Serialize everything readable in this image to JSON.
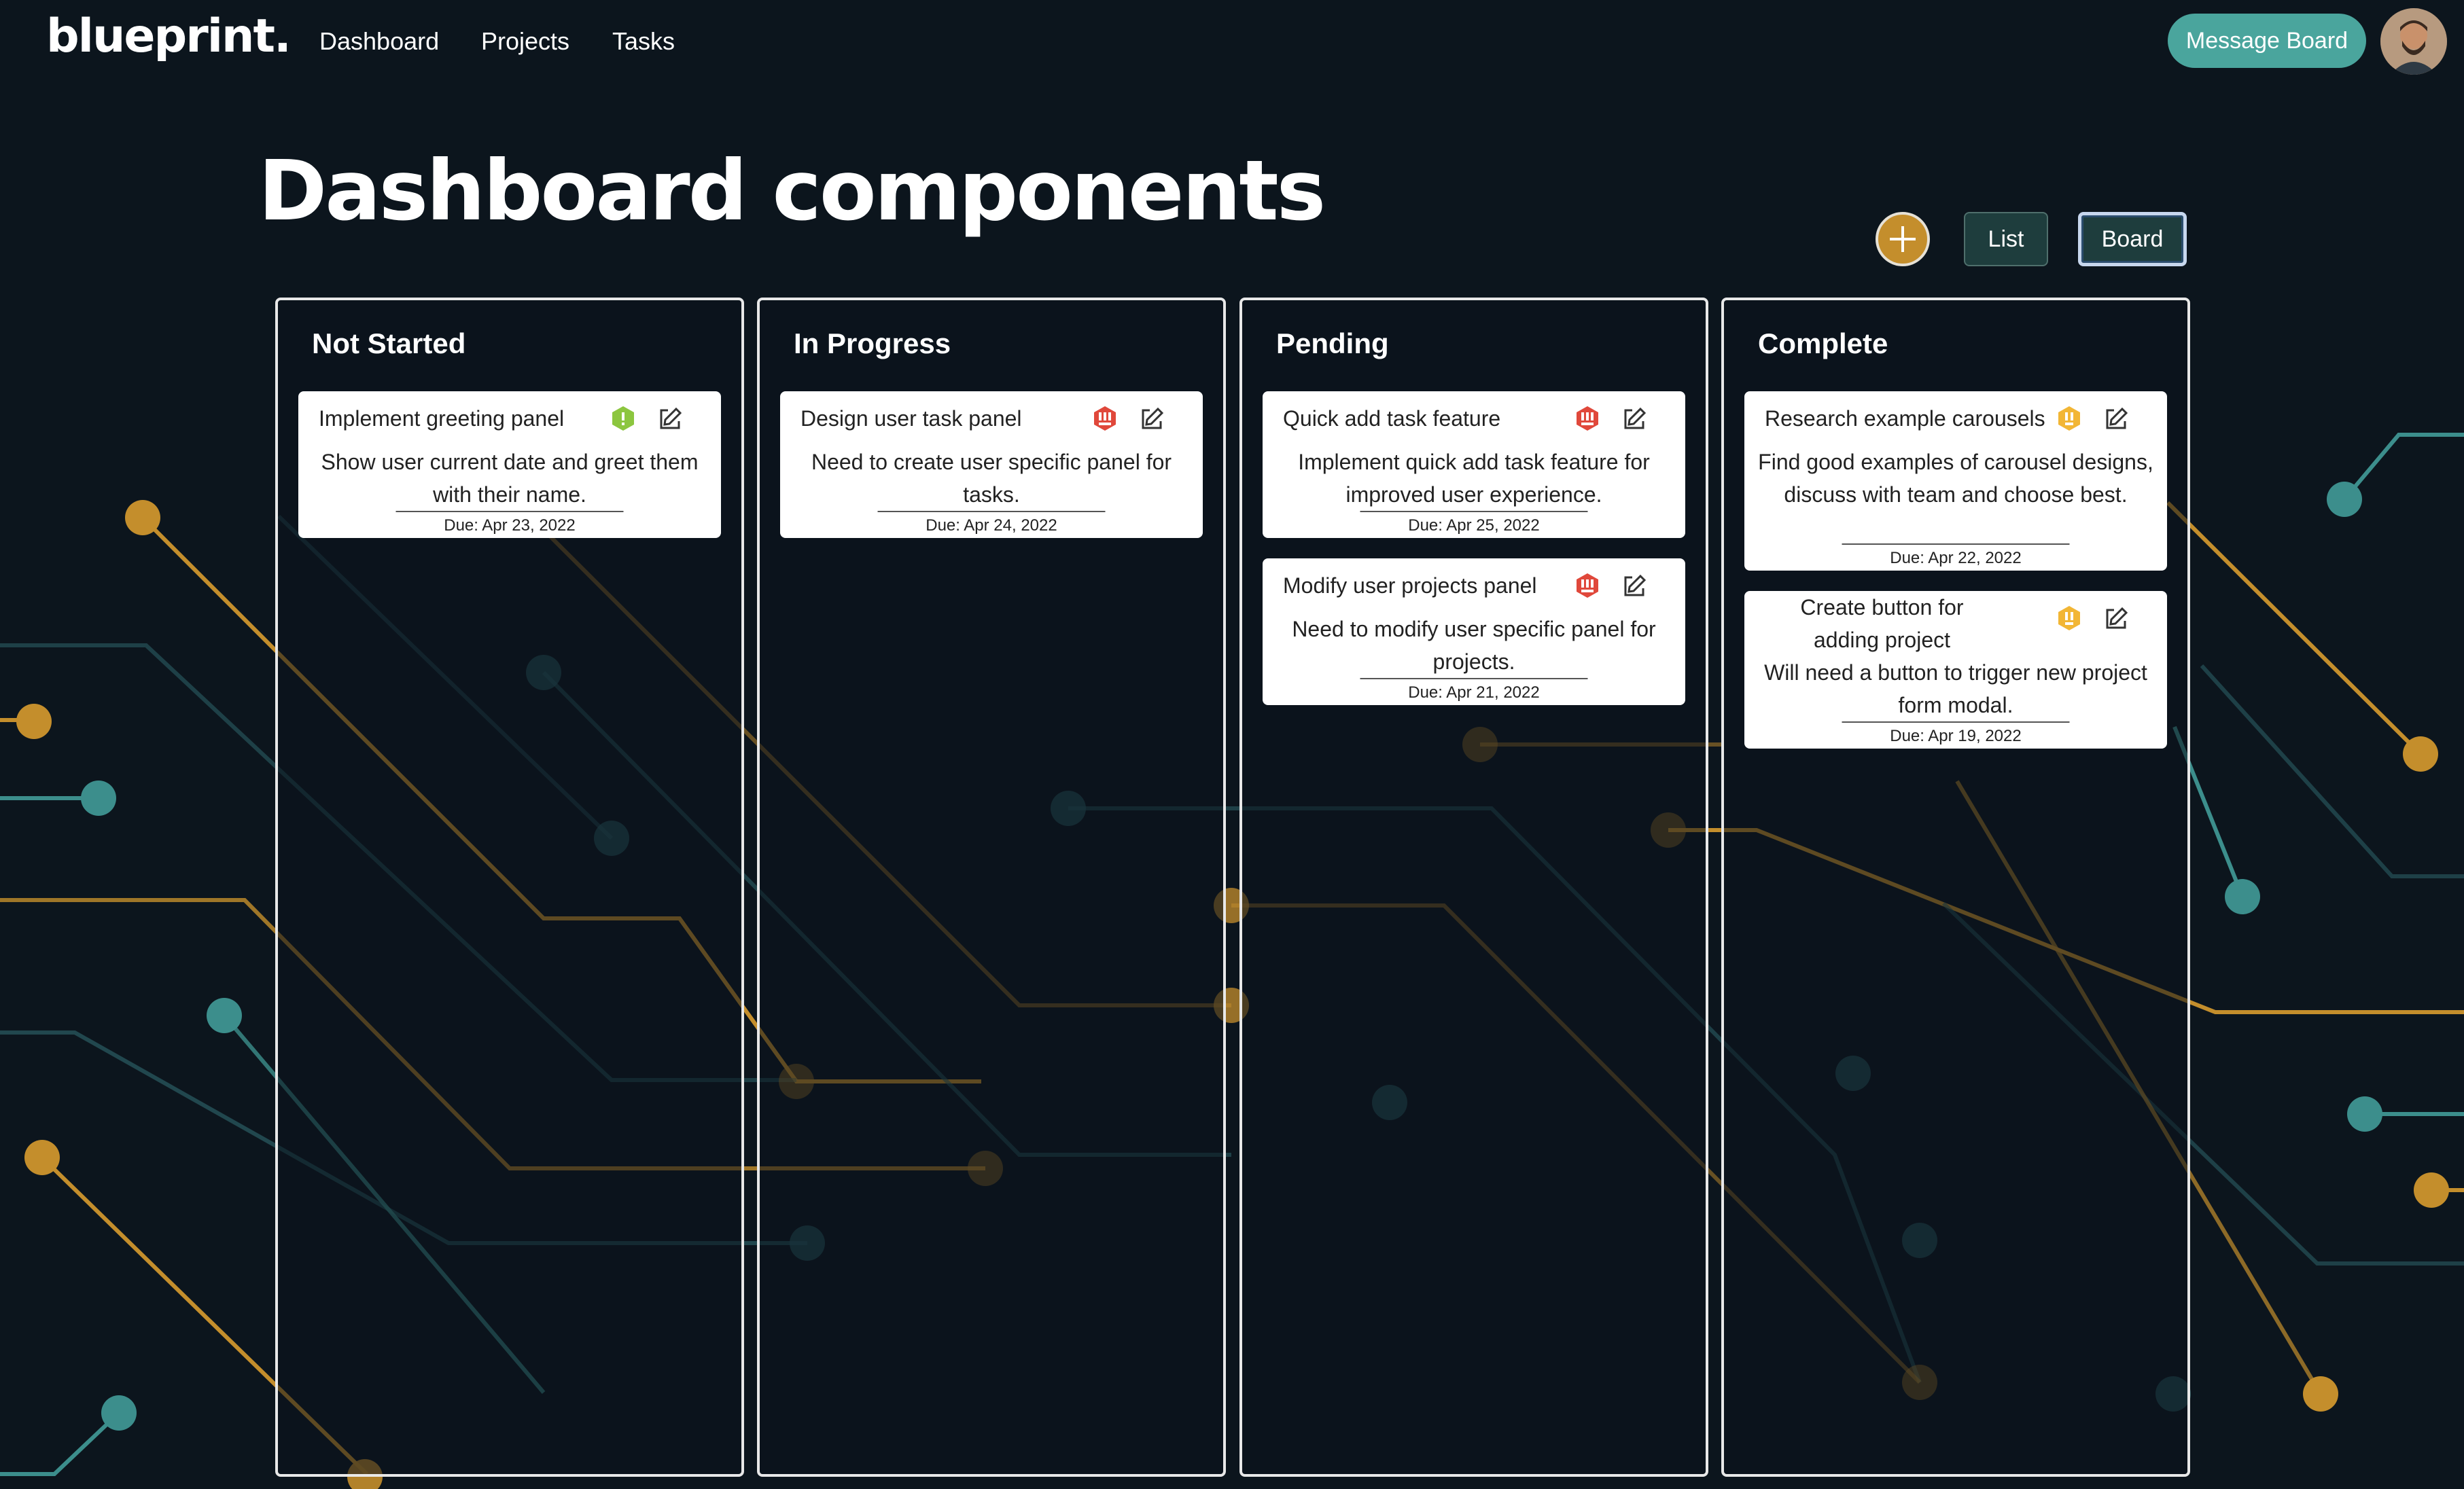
{
  "nav": {
    "logo": "blueprint.",
    "links": [
      "Dashboard",
      "Projects",
      "Tasks"
    ],
    "message_board": "Message Board"
  },
  "page": {
    "title": "Dashboard components"
  },
  "views": {
    "list": "List",
    "board": "Board",
    "active": "Board"
  },
  "colors": {
    "background": "#0c151d",
    "teal": "#4aa59d",
    "gold": "#c48e2c",
    "high_priority": "#e0483b",
    "medium_priority": "#f2b635",
    "low_priority": "#8cc63f"
  },
  "columns": [
    {
      "title": "Not Started",
      "cards": [
        {
          "title": "Implement greeting panel",
          "priority_icon": "low-priority-icon",
          "description": "Show user current date and greet them with their name.",
          "due": "Due: Apr 23, 2022"
        }
      ]
    },
    {
      "title": "In Progress",
      "cards": [
        {
          "title": "Design user task panel",
          "priority_icon": "high-priority-icon",
          "description": "Need to create user specific panel for tasks.",
          "due": "Due: Apr 24, 2022"
        }
      ]
    },
    {
      "title": "Pending",
      "cards": [
        {
          "title": "Quick add task feature",
          "priority_icon": "high-priority-icon",
          "description": "Implement quick add task feature for improved user experience.",
          "due": "Due: Apr 25, 2022"
        },
        {
          "title": "Modify user projects panel",
          "priority_icon": "high-priority-icon",
          "description": "Need to modify user specific panel for projects.",
          "due": "Due: Apr 21, 2022"
        }
      ]
    },
    {
      "title": "Complete",
      "cards": [
        {
          "title": "Research example carousels",
          "priority_icon": "medium-priority-icon",
          "description": "Find good examples of carousel designs, discuss with team and choose best.",
          "due": "Due: Apr 22, 2022"
        },
        {
          "title": "Create button for adding project",
          "priority_icon": "medium-priority-icon",
          "description": "Will need a button to trigger new project form modal.",
          "due": "Due: Apr 19, 2022"
        }
      ]
    }
  ]
}
